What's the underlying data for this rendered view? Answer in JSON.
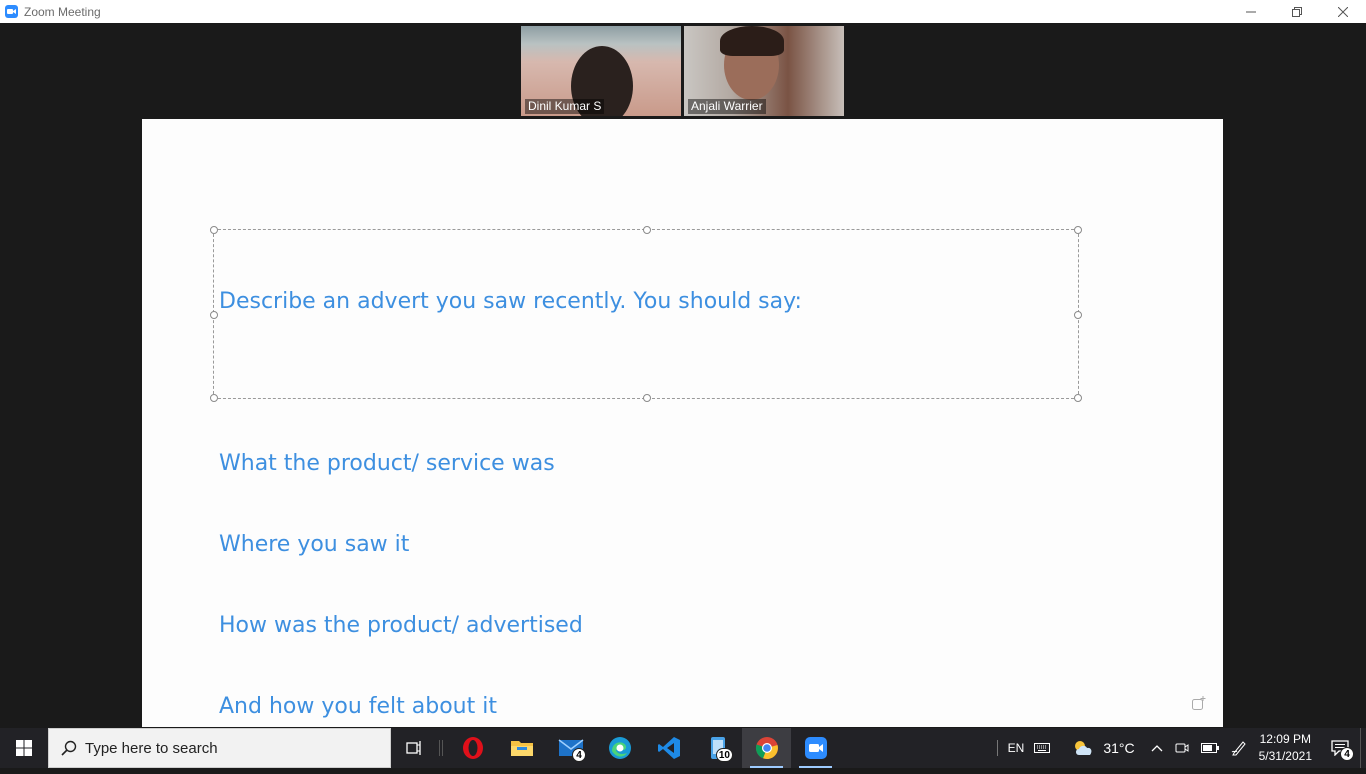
{
  "window": {
    "title": "Zoom Meeting",
    "controls": [
      "minimize",
      "restore",
      "close"
    ]
  },
  "participants": [
    {
      "name": "Dinil Kumar S"
    },
    {
      "name": "Anjali Warrier"
    }
  ],
  "slide": {
    "lines": [
      "Describe an advert you saw recently. You should say:",
      "",
      "What the product/ service was",
      "Where you saw it",
      "How was the product/ advertised",
      "And how you felt about it"
    ],
    "text_color": "#3d8fe0"
  },
  "taskbar": {
    "search_placeholder": "Type here to search",
    "apps": [
      {
        "name": "task-view",
        "badge": ""
      },
      {
        "name": "opera",
        "badge": ""
      },
      {
        "name": "file-explorer",
        "badge": ""
      },
      {
        "name": "mail",
        "badge": "4"
      },
      {
        "name": "edge",
        "badge": ""
      },
      {
        "name": "vscode",
        "badge": ""
      },
      {
        "name": "phone-app",
        "badge": "10"
      },
      {
        "name": "chrome",
        "badge": ""
      },
      {
        "name": "zoom",
        "badge": ""
      }
    ],
    "tray": {
      "language": "EN",
      "temperature": "31°C",
      "time": "12:09 PM",
      "date": "5/31/2021",
      "notifications": "4"
    }
  }
}
